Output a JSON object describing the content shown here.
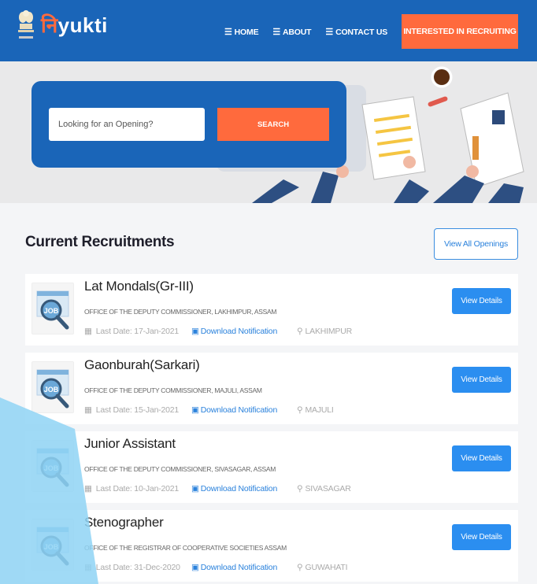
{
  "header": {
    "brand_accent": "नि",
    "brand_rest": "yukti",
    "nav": [
      {
        "label": "HOME"
      },
      {
        "label": "ABOUT"
      },
      {
        "label": "CONTACT US"
      }
    ],
    "cta_label": "INTERESTED IN RECRUITING"
  },
  "hero": {
    "search_placeholder": "Looking for an Opening?",
    "search_button": "SEARCH"
  },
  "section": {
    "title": "Current Recruitments",
    "view_all_label": "View All Openings"
  },
  "jobs": [
    {
      "title": "Lat Mondals(Gr-III)",
      "org": "OFFICE OF THE DEPUTY COMMISSIONER, LAKHIMPUR, ASSAM",
      "last_date": "Last Date: 17-Jan-2021",
      "download": "Download Notification",
      "location": "LAKHIMPUR",
      "button": "View Details",
      "thumb_label": "JOB"
    },
    {
      "title": "Gaonburah(Sarkari)",
      "org": "OFFICE OF THE DEPUTY COMMISSIONER, MAJULI, ASSAM",
      "last_date": "Last Date: 15-Jan-2021",
      "download": "Download Notification",
      "location": "MAJULI",
      "button": "View Details",
      "thumb_label": "JOB"
    },
    {
      "title": "Junior Assistant",
      "org": "OFFICE OF THE DEPUTY COMMISSIONER, SIVASAGAR, ASSAM",
      "last_date": "Last Date: 10-Jan-2021",
      "download": "Download Notification",
      "location": "SIVASAGAR",
      "button": "View Details",
      "thumb_label": "JOB"
    },
    {
      "title": "Stenographer",
      "org": "OFFICE OF THE REGISTRAR OF COOPERATIVE SOCIETIES ASSAM",
      "last_date": "Last Date: 31-Dec-2020",
      "download": "Download Notification",
      "location": "GUWAHATI",
      "button": "View Details",
      "thumb_label": "JOB"
    }
  ],
  "colors": {
    "primary": "#1a65b8",
    "accent": "#ff6a3d",
    "button_blue": "#2b8ef0",
    "decor": "#8fd3f4"
  },
  "icons": [
    "emblem-icon",
    "menu-bars-icon",
    "calendar-icon",
    "pdf-icon",
    "map-marker-icon",
    "job-magnifier-icon"
  ]
}
